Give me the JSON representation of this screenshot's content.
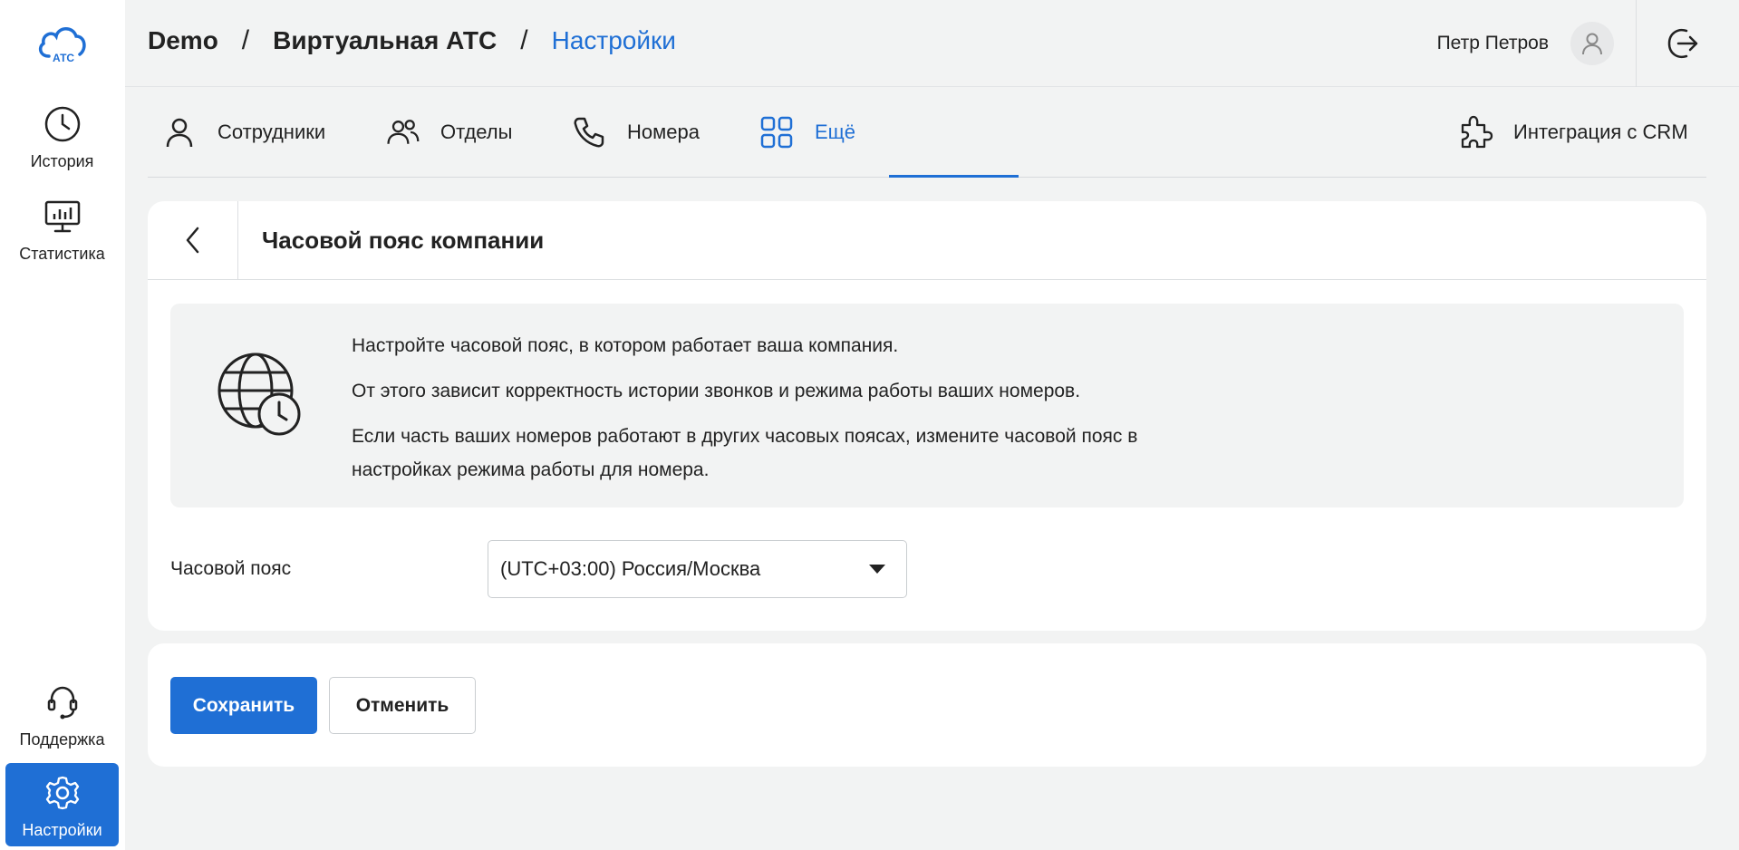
{
  "sidebar": {
    "logo_text": "АТС",
    "items": [
      {
        "label": "История",
        "icon": "clock-icon"
      },
      {
        "label": "Статистика",
        "icon": "monitor-chart-icon"
      },
      {
        "label": "Поддержка",
        "icon": "headset-icon"
      },
      {
        "label": "Настройки",
        "icon": "gear-icon",
        "active": true
      }
    ]
  },
  "header": {
    "breadcrumb": [
      "Demo",
      "Виртуальная АТС",
      "Настройки"
    ],
    "separator": "/",
    "user_name": "Петр Петров",
    "avatar_icon": "user-icon",
    "logout_icon": "logout-icon"
  },
  "tabs": [
    {
      "label": "Сотрудники",
      "icon": "person-icon"
    },
    {
      "label": "Отделы",
      "icon": "people-icon"
    },
    {
      "label": "Номера",
      "icon": "phone-icon"
    },
    {
      "label": "Ещё",
      "icon": "grid-icon",
      "active": true
    },
    {
      "label": "Интеграция с CRM",
      "icon": "puzzle-icon"
    }
  ],
  "card": {
    "title": "Часовой пояс компании",
    "info_lines": [
      "Настройте часовой пояс, в котором работает ваша компания.",
      "От этого зависит корректность истории звонков и режима работы ваших номеров.",
      "Если часть ваших номеров работают в других часовых поясах, измените часовой пояс в",
      "настройках режима работы для номера."
    ],
    "field_label": "Часовой пояс",
    "timezone_value": "(UTC+03:00) Россия/Москва"
  },
  "actions": {
    "save_label": "Сохранить",
    "cancel_label": "Отменить"
  },
  "colors": {
    "accent": "#1f6fd5",
    "background": "#f2f3f3",
    "card": "#ffffff"
  }
}
